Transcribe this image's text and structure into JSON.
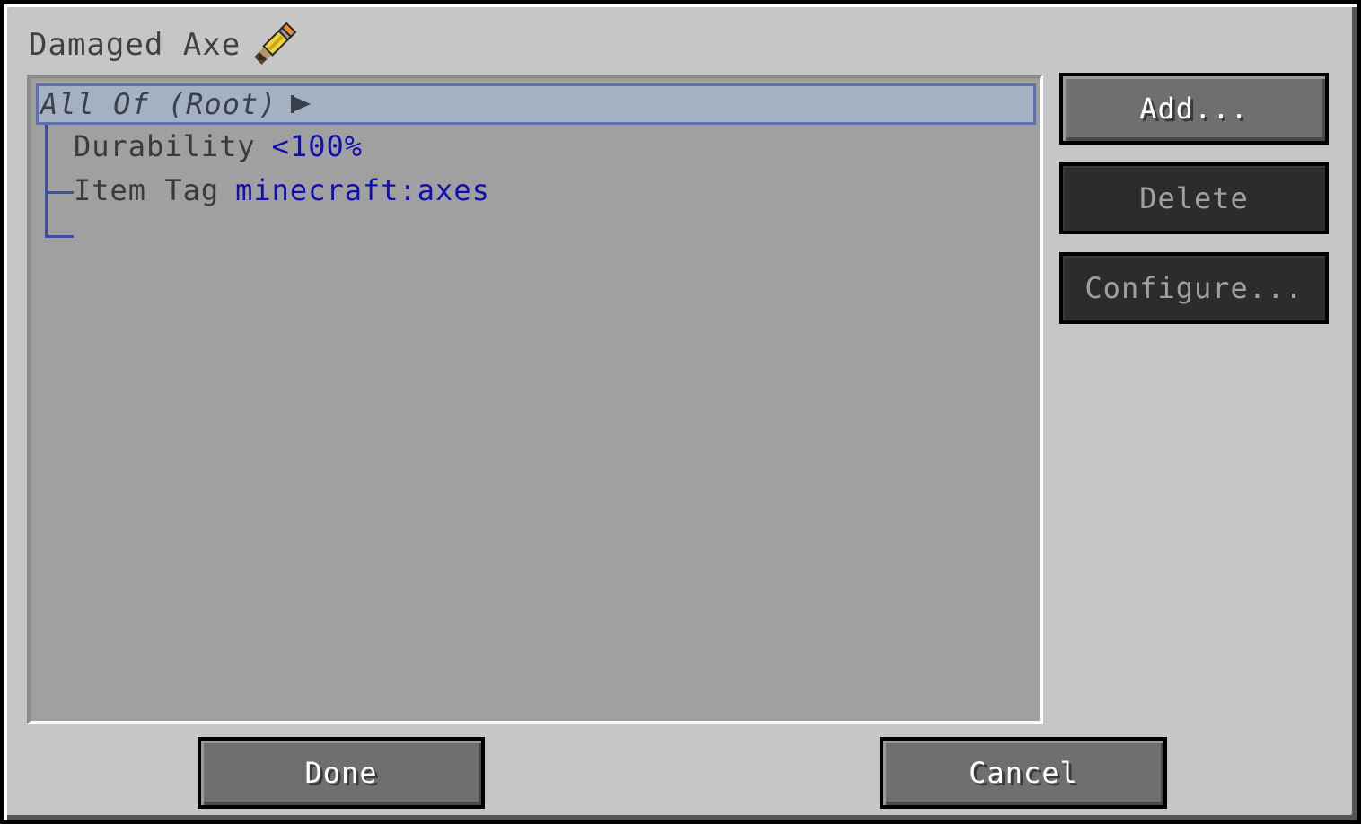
{
  "window": {
    "title": "Damaged Axe",
    "title_icon": "pencil-icon"
  },
  "tree": {
    "root": {
      "label": "All Of (Root)",
      "icon": "play-arrow-icon",
      "selected": true
    },
    "children": [
      {
        "name": "Durability",
        "value": "<100%"
      },
      {
        "name": "Item Tag",
        "value": "minecraft:axes"
      }
    ]
  },
  "side_buttons": {
    "add": "Add...",
    "delete": "Delete",
    "configure": "Configure..."
  },
  "footer": {
    "done": "Done",
    "cancel": "Cancel"
  },
  "colors": {
    "window_bg": "#c6c6c6",
    "panel_bg": "#a0a0a0",
    "selection_bg": "#a3b1c3",
    "selection_border": "#5a71ad",
    "value_text": "#1010b0",
    "button_active": "#6f6f6f",
    "button_disabled": "#2c2c2c"
  }
}
